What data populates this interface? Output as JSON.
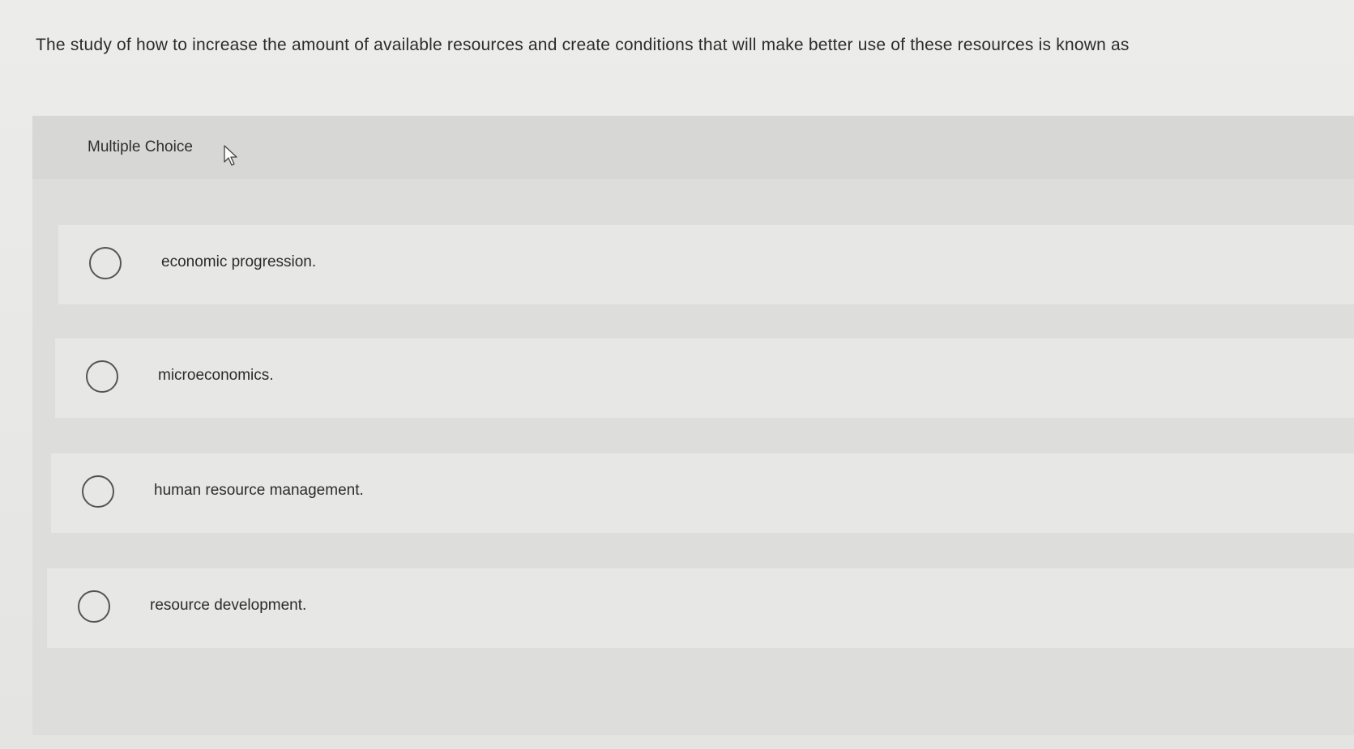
{
  "question": {
    "text": "The study of how to increase the amount of available resources and create conditions that will make better use of these resources is known as"
  },
  "multiple_choice": {
    "label": "Multiple Choice",
    "options": [
      {
        "label": "economic progression."
      },
      {
        "label": "microeconomics."
      },
      {
        "label": "human resource management."
      },
      {
        "label": "resource development."
      }
    ]
  },
  "icons": {
    "cursor": "mouse-pointer-icon"
  }
}
